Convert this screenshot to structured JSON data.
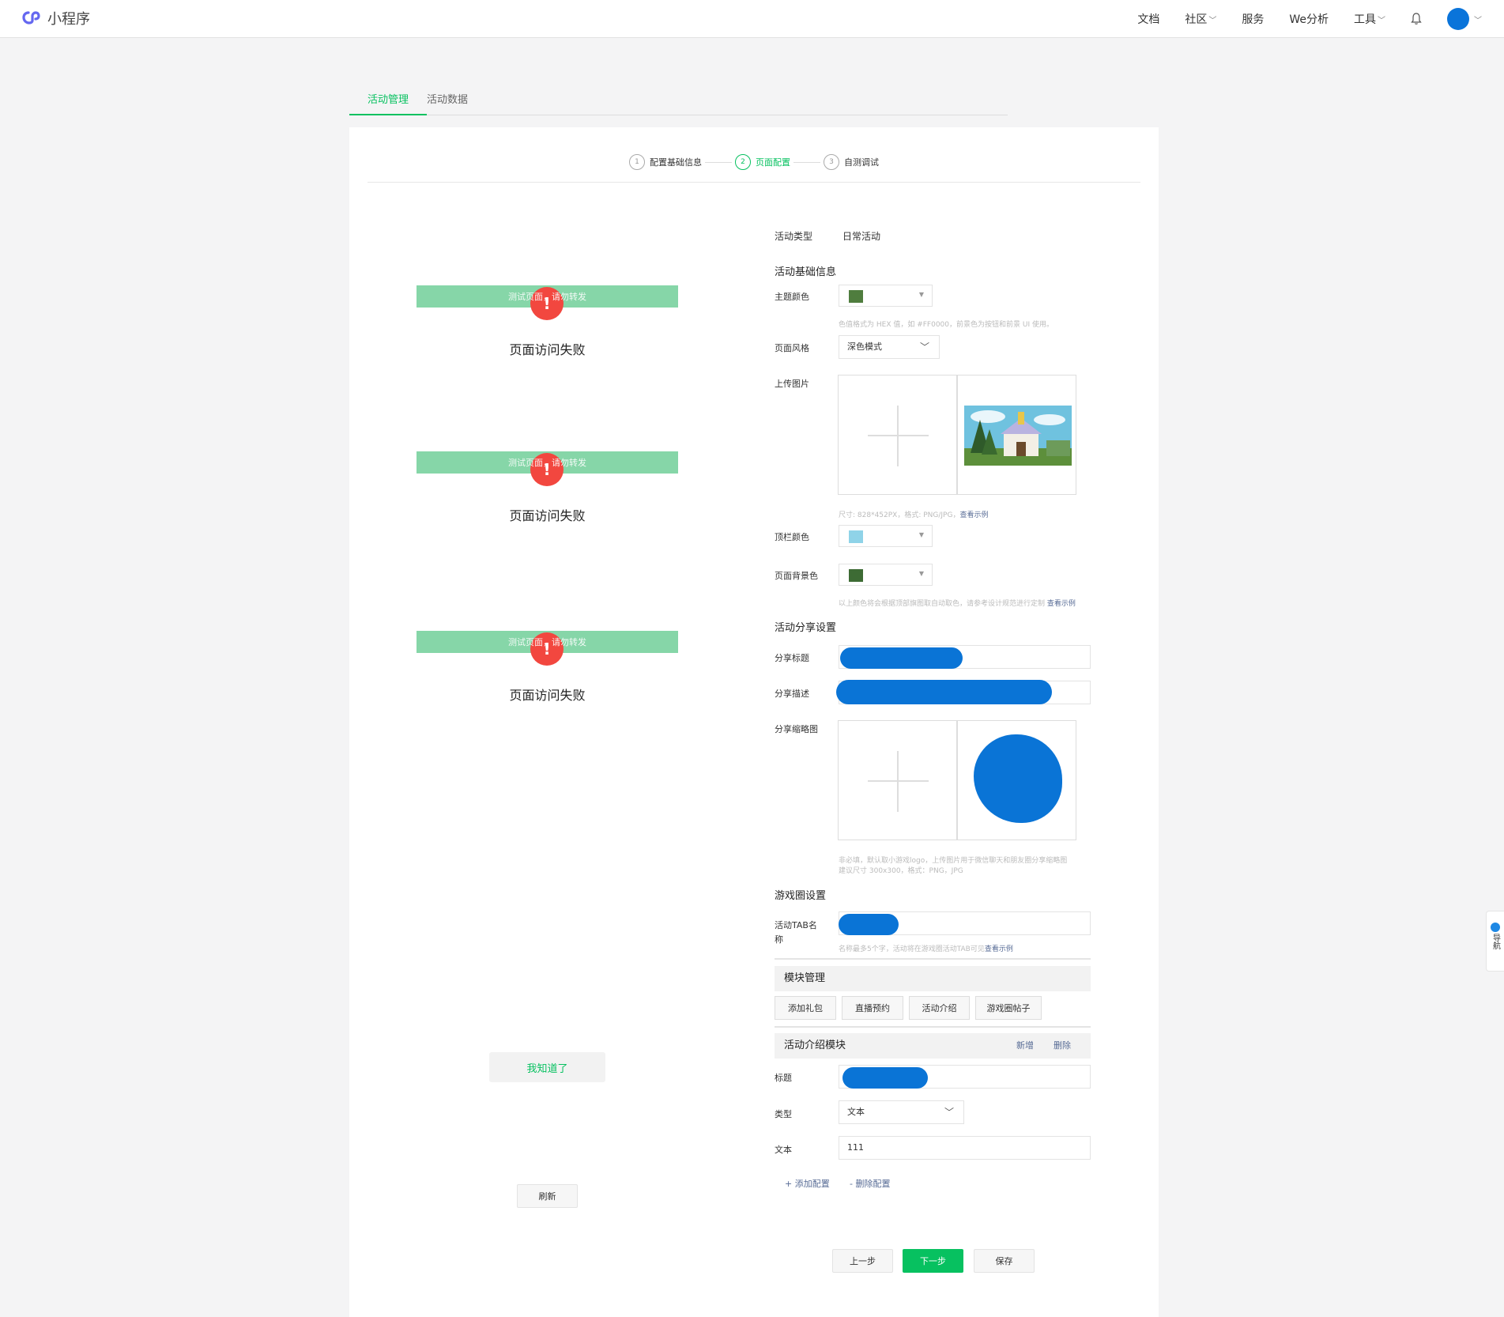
{
  "header": {
    "brand": "小程序",
    "nav": [
      "文档",
      "社区",
      "服务",
      "We分析",
      "工具"
    ]
  },
  "tabs": [
    "活动管理",
    "活动数据"
  ],
  "steps": [
    {
      "num": "1",
      "label": "配置基础信息"
    },
    {
      "num": "2",
      "label": "页面配置"
    },
    {
      "num": "3",
      "label": "自测调试"
    }
  ],
  "preview": {
    "bar_text": "测试页面，请勿转发",
    "error_icon": "!",
    "error_msg": "页面访问失败",
    "know_button": "我知道了",
    "refresh_button": "刷新"
  },
  "form": {
    "activity_type_label": "活动类型",
    "activity_type_value": "日常活动",
    "basic_section": "活动基础信息",
    "theme_color_label": "主题颜色",
    "theme_color": "#4f7d3e",
    "theme_color_hint": "色值格式为 HEX 值，如 #FF0000，前景色为按钮和前景 UI 使用。",
    "page_style_label": "页面风格",
    "page_style_value": "深色模式",
    "upload_label": "上传图片",
    "upload_hint": "尺寸: 828*452PX，格式: PNG/JPG，",
    "view_example": "查看示例",
    "topbar_color_label": "顶栏颜色",
    "topbar_color": "#8fd3e8",
    "bg_color_label": "页面背景色",
    "bg_color": "#3d6b34",
    "color_hint": "以上颜色将会根据顶部旗图取自动取色，请参考设计规范进行定制",
    "share_section": "活动分享设置",
    "share_title_label": "分享标题",
    "share_desc_label": "分享描述",
    "share_thumb_label": "分享缩略图",
    "share_thumb_hint_1": "非必填，默认取小游戏logo，上传图片用于微信聊天和朋友圈分享缩略图",
    "share_thumb_hint_2": "建议尺寸 300x300，格式：PNG，JPG",
    "game_section": "游戏圈设置",
    "tab_name_label_1": "活动TAB名",
    "tab_name_label_2": "称",
    "tab_name_hint": "名称最多5个字，活动将在游戏圈活动TAB可见",
    "module_section": "模块管理",
    "module_buttons": [
      "添加礼包",
      "直播预约",
      "活动介绍",
      "游戏圈帖子"
    ],
    "intro_module": "活动介绍模块",
    "intro_add": "新增",
    "intro_delete": "删除",
    "title_label": "标题",
    "type_label": "类型",
    "type_value": "文本",
    "text_label": "文本",
    "text_value": "111",
    "add_config": "+ 添加配置",
    "remove_config": "- 删除配置"
  },
  "footer": {
    "prev": "上一步",
    "next": "下一步",
    "save": "保存"
  },
  "float_nav": {
    "label": "导航"
  }
}
